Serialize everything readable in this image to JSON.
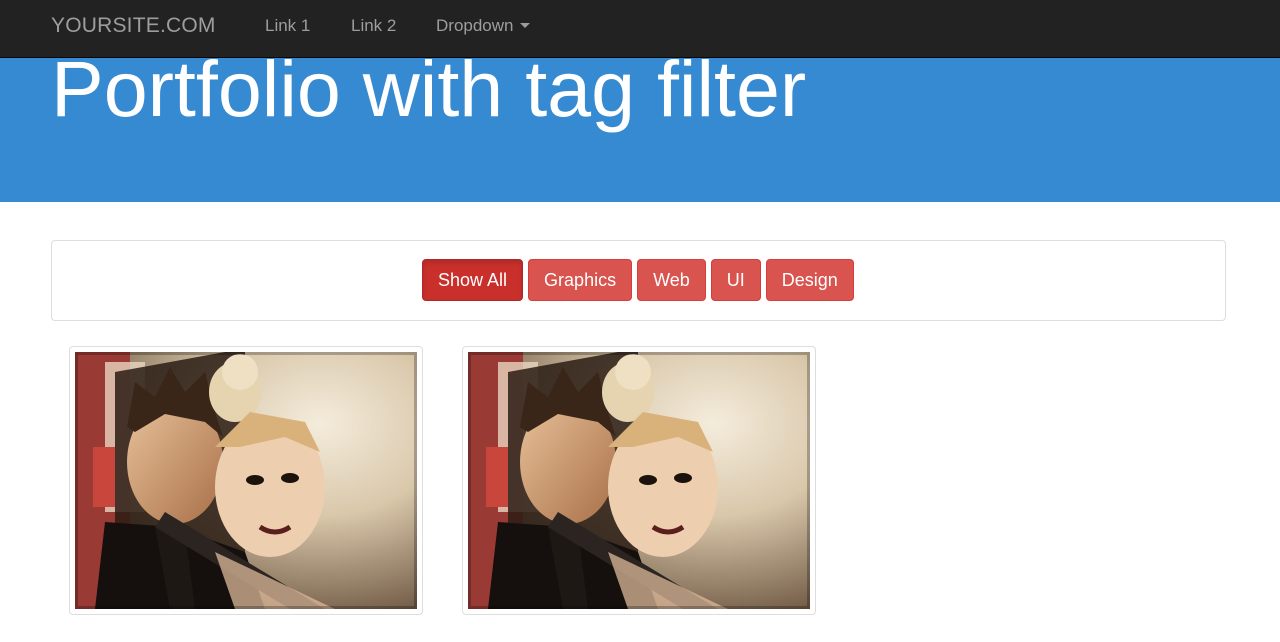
{
  "navbar": {
    "brand": "YOURSITE.COM",
    "links": [
      "Link 1",
      "Link 2"
    ],
    "dropdown_label": "Dropdown"
  },
  "jumbotron": {
    "title": "Portfolio with tag filter"
  },
  "filters": {
    "buttons": [
      "Show All",
      "Graphics",
      "Web",
      "UI",
      "Design"
    ],
    "active": "Show All"
  },
  "portfolio": {
    "items_count_visible": 2
  },
  "colors": {
    "navbar_bg": "#222222",
    "jumbotron_bg": "#368ad1",
    "filter_button": "#d9534f",
    "filter_button_active": "#c9302c"
  },
  "icons": [
    "caret-down-icon"
  ]
}
